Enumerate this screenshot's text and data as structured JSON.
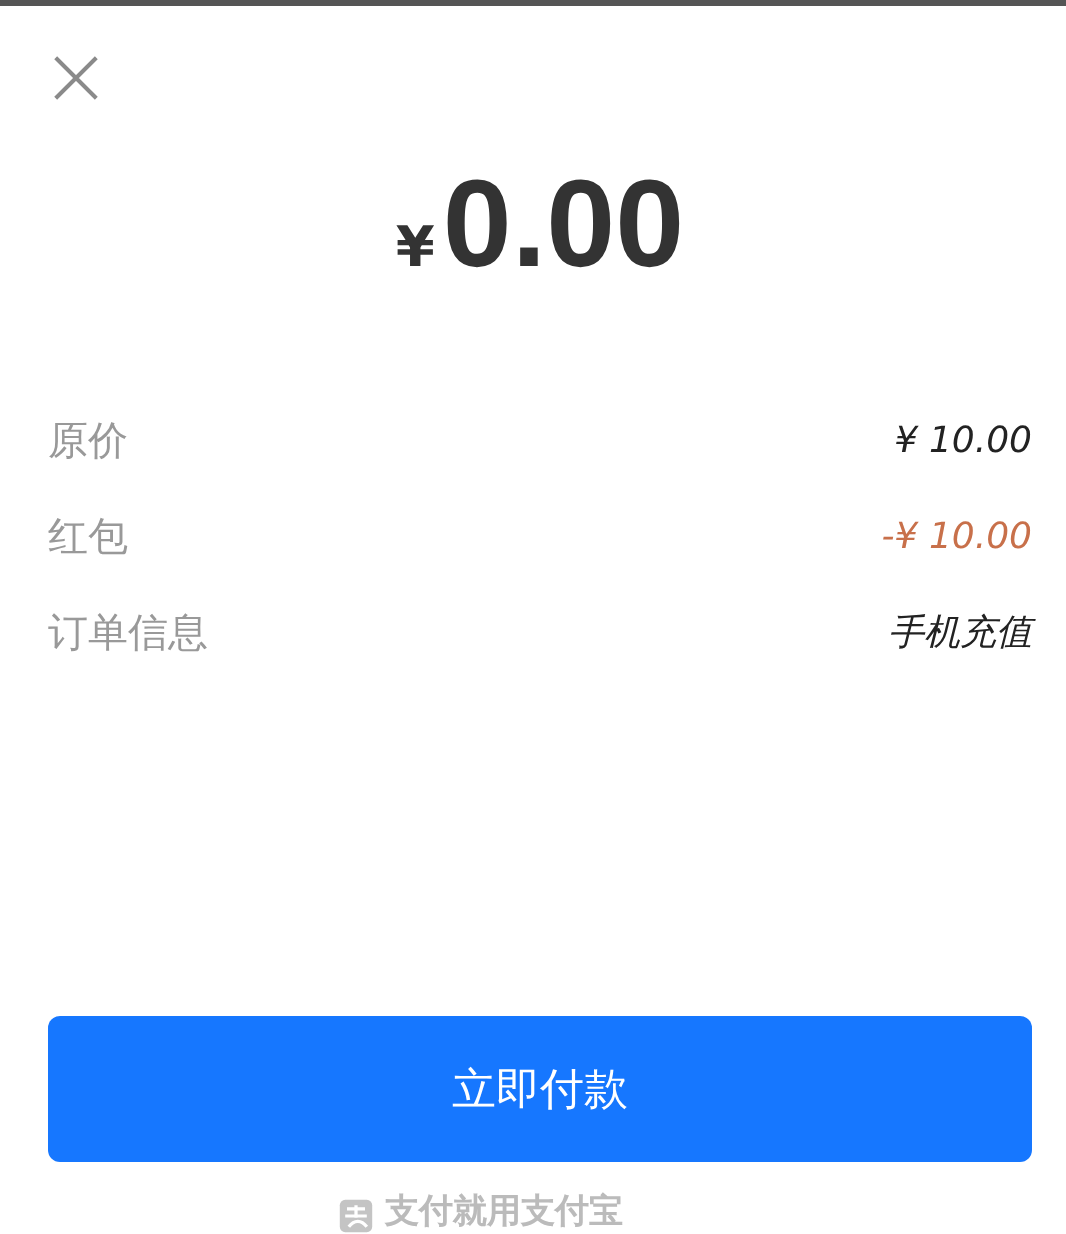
{
  "amount": {
    "currency": "¥",
    "value": "0.00"
  },
  "details": [
    {
      "label": "原价",
      "value": "¥ 10.00",
      "kind": "normal"
    },
    {
      "label": "红包",
      "value": "-¥ 10.00",
      "kind": "discount"
    },
    {
      "label": "订单信息",
      "value": "手机充值",
      "kind": "normal"
    }
  ],
  "pay_button": "立即付款",
  "footer": "支付就用支付宝"
}
